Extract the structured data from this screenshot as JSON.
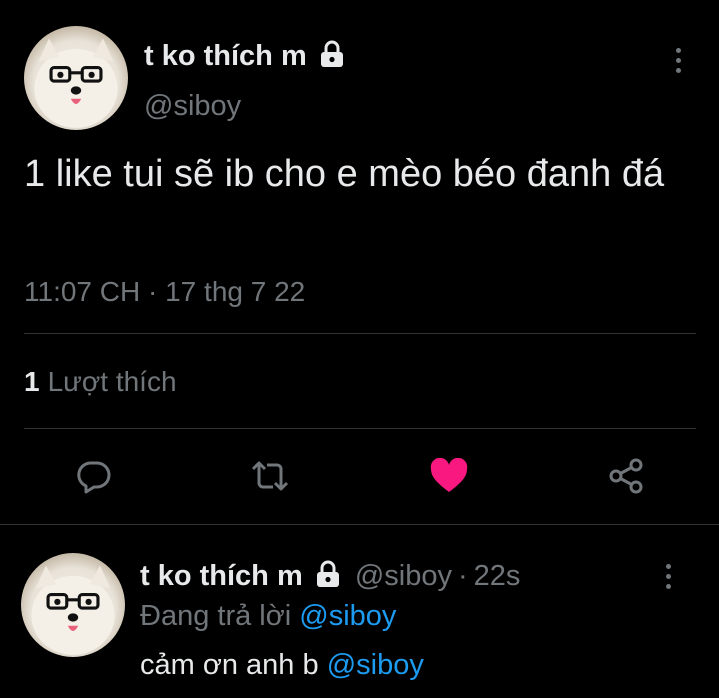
{
  "main_tweet": {
    "display_name": "t ko thích m",
    "handle": "@siboy",
    "text": "1 like tui sẽ ib cho e mèo béo đanh đá",
    "time": "11:07 CH",
    "separator": "·",
    "date": "17 thg 7 22",
    "likes_count": "1",
    "likes_label": "Lượt thích",
    "liked": true
  },
  "reply_tweet": {
    "display_name": "t ko thích m",
    "handle": "@siboy",
    "separator": "·",
    "time": "22s",
    "replying_prefix": "Đang trả lời",
    "replying_to": "@siboy",
    "text_prefix": "cảm ơn anh b",
    "text_mention": "@siboy"
  },
  "icons": {
    "protected": "lock-icon",
    "more": "more-vertical-icon",
    "reply": "reply-icon",
    "retweet": "retweet-icon",
    "like": "heart-icon",
    "share": "share-icon"
  },
  "colors": {
    "background": "#000000",
    "text": "#e7e9ea",
    "secondary": "#71767b",
    "divider": "#2f3336",
    "accent": "#1d9bf0",
    "like": "#f91880"
  }
}
